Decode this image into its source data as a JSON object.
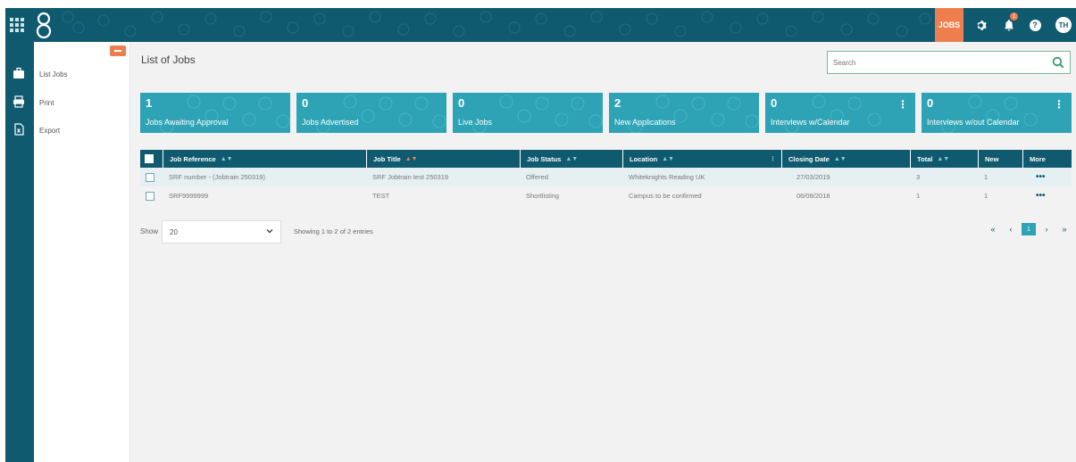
{
  "topbar": {
    "jobs_label": "JOBS",
    "notification_count": "1",
    "avatar_initials": "TH",
    "help_glyph": "?",
    "icons": [
      "apps-grid-icon",
      "logo",
      "gear-icon",
      "bell-icon",
      "help-icon"
    ]
  },
  "sidemenu": {
    "items": [
      {
        "label": "List Jobs",
        "icon": "briefcase-icon"
      },
      {
        "label": "Print",
        "icon": "printer-icon"
      },
      {
        "label": "Export",
        "icon": "excel-file-icon"
      }
    ]
  },
  "main": {
    "title": "List of Jobs",
    "search_placeholder": "Search"
  },
  "stats": [
    {
      "value": "1",
      "label": "Jobs Awaiting Approval",
      "has_menu": false
    },
    {
      "value": "0",
      "label": "Jobs Advertised",
      "has_menu": false
    },
    {
      "value": "0",
      "label": "Live Jobs",
      "has_menu": false
    },
    {
      "value": "2",
      "label": "New Applications",
      "has_menu": false
    },
    {
      "value": "0",
      "label": "Interviews w/Calendar",
      "has_menu": true
    },
    {
      "value": "0",
      "label": "Interviews w/out Calendar",
      "has_menu": true
    }
  ],
  "table": {
    "columns": [
      "Job Reference",
      "Job Title",
      "Job Status",
      "Location",
      "Closing Date",
      "Total",
      "New",
      "More"
    ],
    "rows": [
      [
        "SRF number - (Jobtrain 250319)",
        "SRF Jobtrain test 250319",
        "Offered",
        "Whiteknights Reading UK",
        "27/03/2019",
        "3",
        "1",
        "•••"
      ],
      [
        "SRF9999999",
        "TEST",
        "Shortlisting",
        "Campus to be confirmed",
        "06/08/2018",
        "1",
        "1",
        "•••"
      ]
    ]
  },
  "pagination": {
    "show_label": "Show",
    "page_size": "20",
    "entries_text": "Showing 1 to 2 of 2 entries",
    "first": "«",
    "prev": "‹",
    "current": "1",
    "next": "›",
    "last": "»"
  },
  "colors": {
    "brand_dark": "#0f5a6e",
    "card_teal": "#2da3b5",
    "accent_orange": "#ef7e4f"
  }
}
